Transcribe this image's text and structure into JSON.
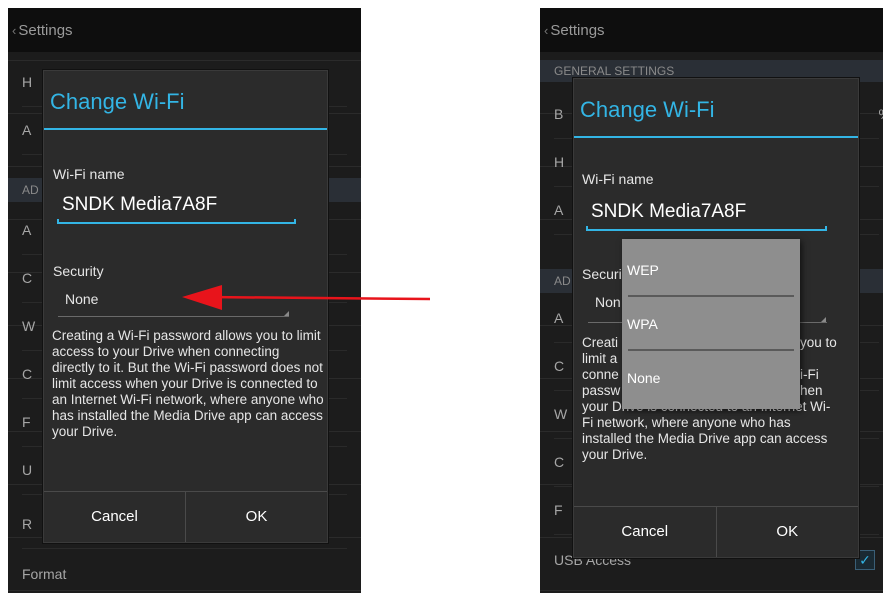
{
  "left": {
    "topbar": {
      "back_glyph": "‹",
      "title": "Settings"
    },
    "bg_section": "AD",
    "bg_items": [
      "H",
      "A",
      "A",
      "C",
      "W",
      "C",
      "F",
      "U",
      "R",
      "Format"
    ],
    "dialog": {
      "title": "Change Wi-Fi",
      "wifi_name_label": "Wi-Fi name",
      "wifi_name_value": "SNDK Media7A8F",
      "security_label": "Security",
      "security_value": "None",
      "description": "Creating a Wi-Fi password allows you to limit access to your Drive when connecting directly to it. But the Wi-Fi password does not limit access when your Drive is connected to an Internet Wi-Fi network, where anyone who has installed the Media Drive app can access your Drive.",
      "cancel": "Cancel",
      "ok": "OK"
    },
    "arrow_color": "#e8141b"
  },
  "right": {
    "topbar": {
      "back_glyph": "‹",
      "title": "Settings"
    },
    "general_section": "GENERAL SETTINGS",
    "bg_section": "AD",
    "bg_items": [
      "B",
      "H",
      "A",
      "A",
      "C",
      "W",
      "C",
      "F"
    ],
    "usb_access": "USB Access",
    "pct": "%",
    "dialog": {
      "title": "Change Wi-Fi",
      "wifi_name_label": "Wi-Fi name",
      "wifi_name_value": "SNDK Media7A8F",
      "security_label": "Securi",
      "security_value": "Non",
      "desc_lines": [
        "Creati",
        "you to",
        "limit a",
        "conne",
        "i-Fi",
        "passw",
        "hen",
        "your Drive is connected to an Internet Wi-",
        "Fi network, where anyone who has",
        "installed the Media Drive app can access",
        "your Drive."
      ],
      "cancel": "Cancel",
      "ok": "OK"
    },
    "popup_options": [
      "WEP",
      "WPA",
      "None"
    ]
  },
  "colors": {
    "accent": "#33b5e5",
    "dialog_bg": "#2b2b2b",
    "popup_bg": "#8e8e8e"
  }
}
